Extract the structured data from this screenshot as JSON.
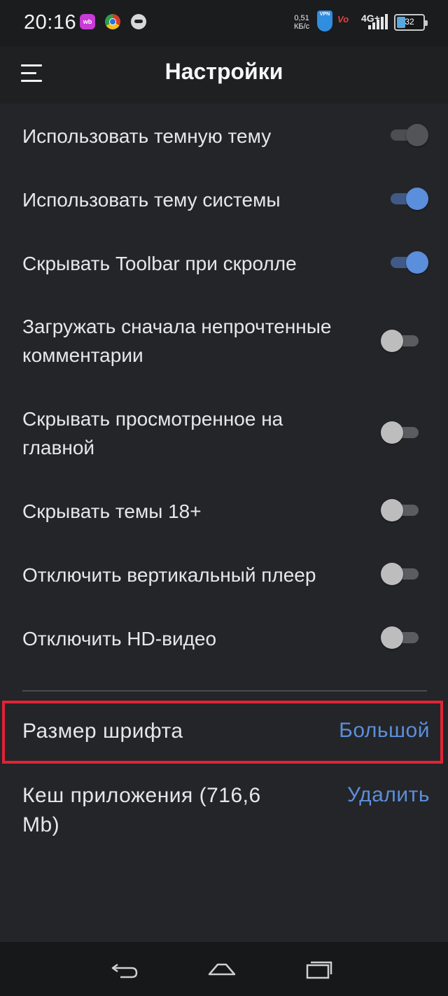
{
  "status_bar": {
    "time": "20:16",
    "speed_value": "0,51",
    "speed_unit": "КБ/с",
    "vpn_label": "VPN",
    "vo_label": "Vo",
    "network": "4G+",
    "battery": "32",
    "battery_fraction": 0.32,
    "app_icons": [
      "wb-icon",
      "chrome-icon",
      "robot-icon"
    ]
  },
  "toolbar": {
    "title": "Настройки",
    "menu_icon": "hamburger-menu-icon"
  },
  "settings": [
    {
      "label": "Использовать темную тему",
      "enabled": false
    },
    {
      "label": "Использовать тему системы",
      "enabled": true
    },
    {
      "label": "Скрывать Toolbar при скролле",
      "enabled": true
    },
    {
      "label": "Загружать сначала непрочтенные комментарии",
      "enabled": false
    },
    {
      "label": "Скрывать просмотренное на главной",
      "enabled": false
    },
    {
      "label": "Скрывать темы 18+",
      "enabled": false
    },
    {
      "label": "Отключить вертикальный плеер",
      "enabled": false
    },
    {
      "label": "Отключить HD-видео",
      "enabled": false
    }
  ],
  "font_size": {
    "label": "Размер шрифта",
    "value": "Большой"
  },
  "cache": {
    "label": "Кеш приложения (716,6 Mb)",
    "action": "Удалить"
  },
  "colors": {
    "background": "#242528",
    "accent": "#5b8edb",
    "highlight_border": "#e12335"
  },
  "nav_bar": {
    "icons": [
      "back-icon",
      "home-icon",
      "recents-icon"
    ]
  }
}
